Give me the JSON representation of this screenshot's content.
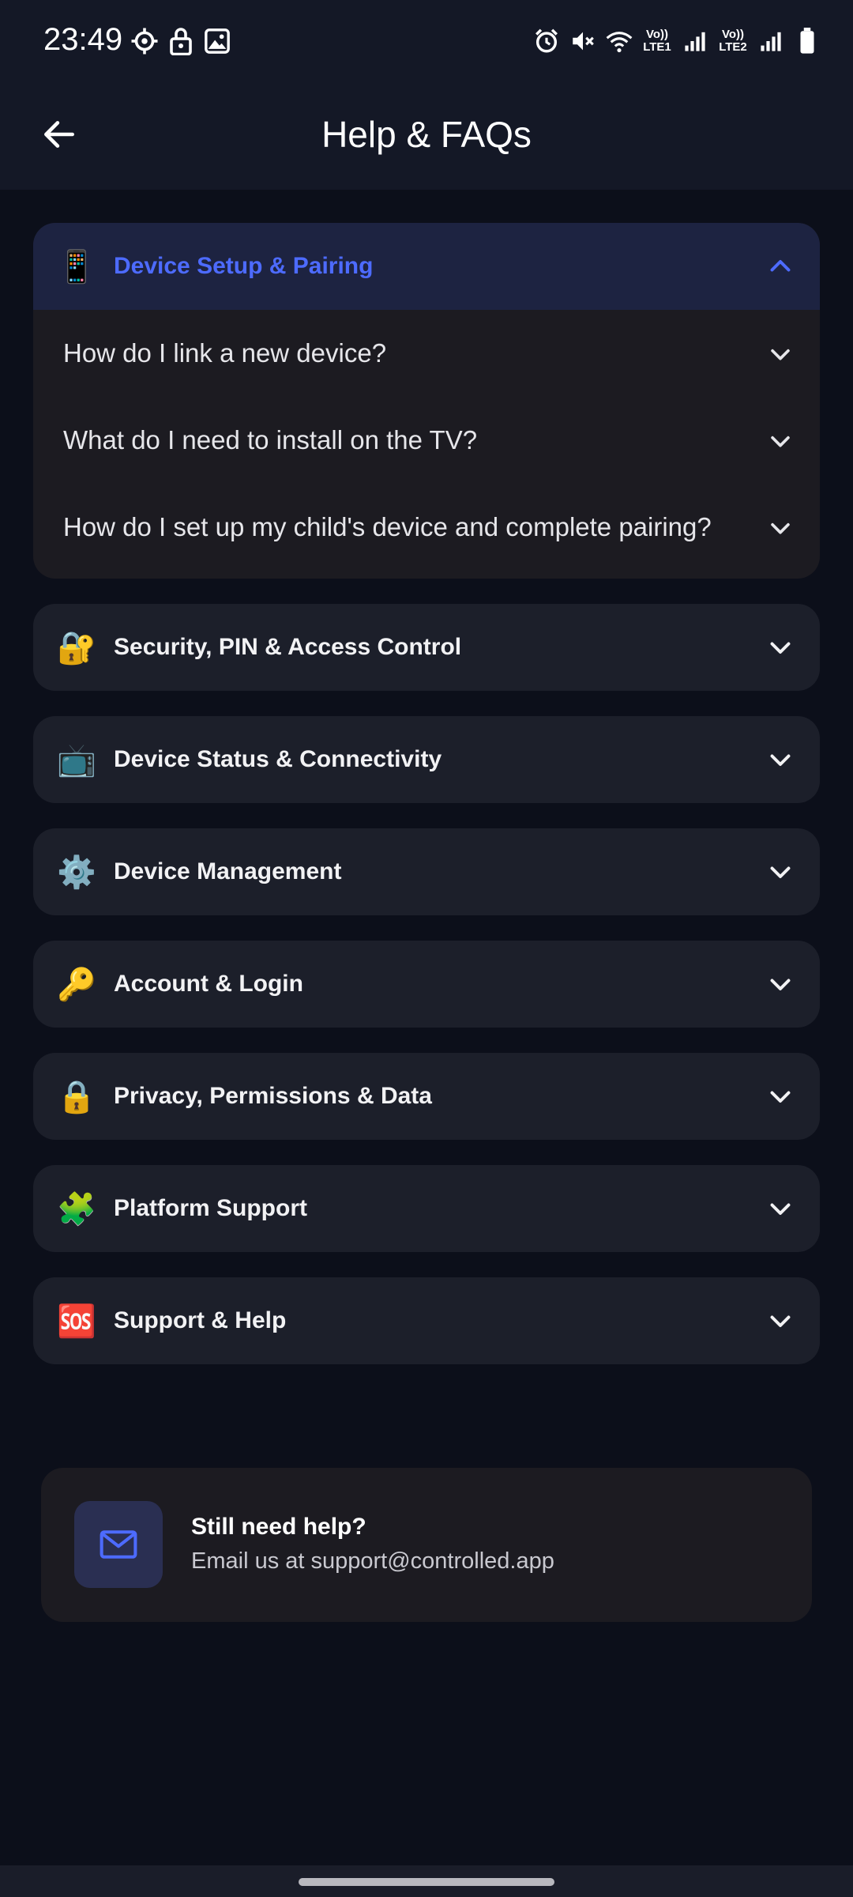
{
  "status_bar": {
    "time": "23:49",
    "left_icons": [
      "settings-icon",
      "lock-icon",
      "image-icon"
    ],
    "right_icons": [
      "alarm-icon",
      "mute-icon",
      "wifi-icon",
      "lte1-signal-icon",
      "lte2-signal-icon",
      "battery-icon"
    ],
    "lte1_label": "Vo)) LTE1",
    "lte2_label": "Vo)) LTE2"
  },
  "app_bar": {
    "title": "Help & FAQs",
    "back_icon": "arrow-left-icon"
  },
  "sections": [
    {
      "emoji": "📱",
      "icon": "mobile-phone-icon",
      "title": "Device Setup & Pairing",
      "expanded": true,
      "questions": [
        "How do I link a new device?",
        "What do I need to install on the TV?",
        "How do I set up my child's device and complete pairing?"
      ]
    },
    {
      "emoji": "🔐",
      "icon": "lock-with-key-icon",
      "title": "Security, PIN & Access Control",
      "expanded": false
    },
    {
      "emoji": "📺",
      "icon": "television-icon",
      "title": "Device Status & Connectivity",
      "expanded": false
    },
    {
      "emoji": "⚙️",
      "icon": "gear-icon",
      "title": "Device Management",
      "expanded": false
    },
    {
      "emoji": "🔑",
      "icon": "key-icon",
      "title": "Account & Login",
      "expanded": false
    },
    {
      "emoji": "🔒",
      "icon": "padlock-icon",
      "title": "Privacy, Permissions & Data",
      "expanded": false
    },
    {
      "emoji": "🧩",
      "icon": "puzzle-piece-icon",
      "title": "Platform Support",
      "expanded": false
    },
    {
      "emoji": "🆘",
      "icon": "sos-icon",
      "title": "Support & Help",
      "expanded": false
    }
  ],
  "help_card": {
    "icon": "mail-icon",
    "title": "Still need help?",
    "subtitle": "Email us at support@controlled.app"
  },
  "colors": {
    "background": "#0c0f1a",
    "card": "#1c1f2a",
    "accent": "#4d6bff",
    "open_header": "#1d2341"
  }
}
